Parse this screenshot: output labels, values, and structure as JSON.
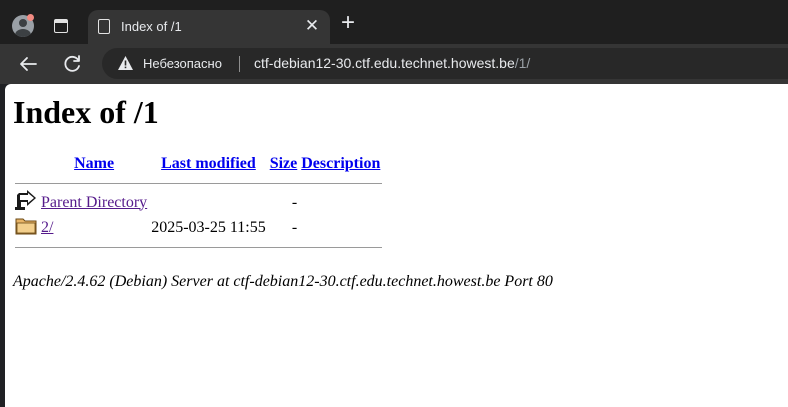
{
  "browser": {
    "tab": {
      "title": "Index of /1"
    },
    "toolbar": {
      "security_label": "Небезопасно",
      "url_host": "ctf-debian12-30.ctf.edu.technet.howest.be",
      "url_path": "/1/"
    },
    "colors": {
      "chrome_bg": "#1f1f1f",
      "toolbar_bg": "#353535",
      "omnibox_bg": "#282828"
    }
  },
  "page": {
    "heading": "Index of /1",
    "columns": {
      "name": "Name",
      "last_modified": "Last modified",
      "size": "Size",
      "description": "Description"
    },
    "rows": [
      {
        "icon": "parent-directory-icon",
        "name": "Parent Directory",
        "last_modified": "",
        "size": "-",
        "description": ""
      },
      {
        "icon": "folder-icon",
        "name": "2/",
        "last_modified": "2025-03-25 11:55",
        "size": "-",
        "description": ""
      }
    ],
    "server_signature": "Apache/2.4.62 (Debian) Server at ctf-debian12-30.ctf.edu.technet.howest.be Port 80",
    "colors": {
      "link": "#0000ee",
      "visited_link": "#551a8b"
    }
  }
}
